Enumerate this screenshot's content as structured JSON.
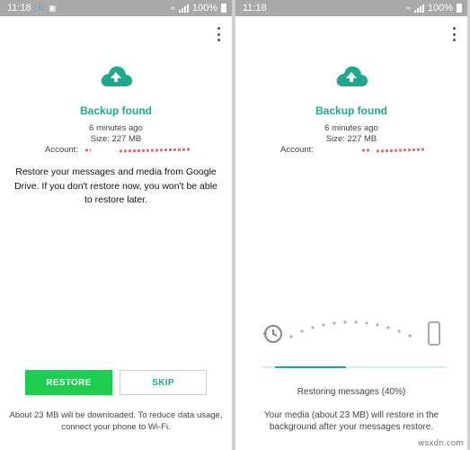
{
  "left": {
    "status_time": "11:18",
    "status_battery": "100%",
    "title": "Backup found",
    "time_ago": "6 minutes ago",
    "size": "Size: 227 MB",
    "account_label": "Account:",
    "description": "Restore your messages and media from Google Drive. If you don't restore now, you won't be able to restore later.",
    "restore_label": "RESTORE",
    "skip_label": "SKIP",
    "footer": "About 23 MB will be downloaded. To reduce data usage, connect your phone to Wi-Fi."
  },
  "right": {
    "status_time": "11:18",
    "status_battery": "100%",
    "title": "Backup found",
    "time_ago": "6 minutes ago",
    "size": "Size: 227 MB",
    "account_label": "Account:",
    "restoring": "Restoring messages (40%)",
    "restore_progress": 0.4,
    "media_note": "Your media (about 23 MB) will restore in the background after your messages restore."
  },
  "watermark": "wsxdn.com",
  "colors": {
    "accent": "#1ea98f",
    "restore_button": "#1ecd50",
    "statusbar": "#a9a9a9"
  },
  "icons": {
    "cloud": "cloud-upload-icon",
    "menu": "more-vert-icon",
    "history": "history-icon",
    "device": "smartphone-icon"
  }
}
